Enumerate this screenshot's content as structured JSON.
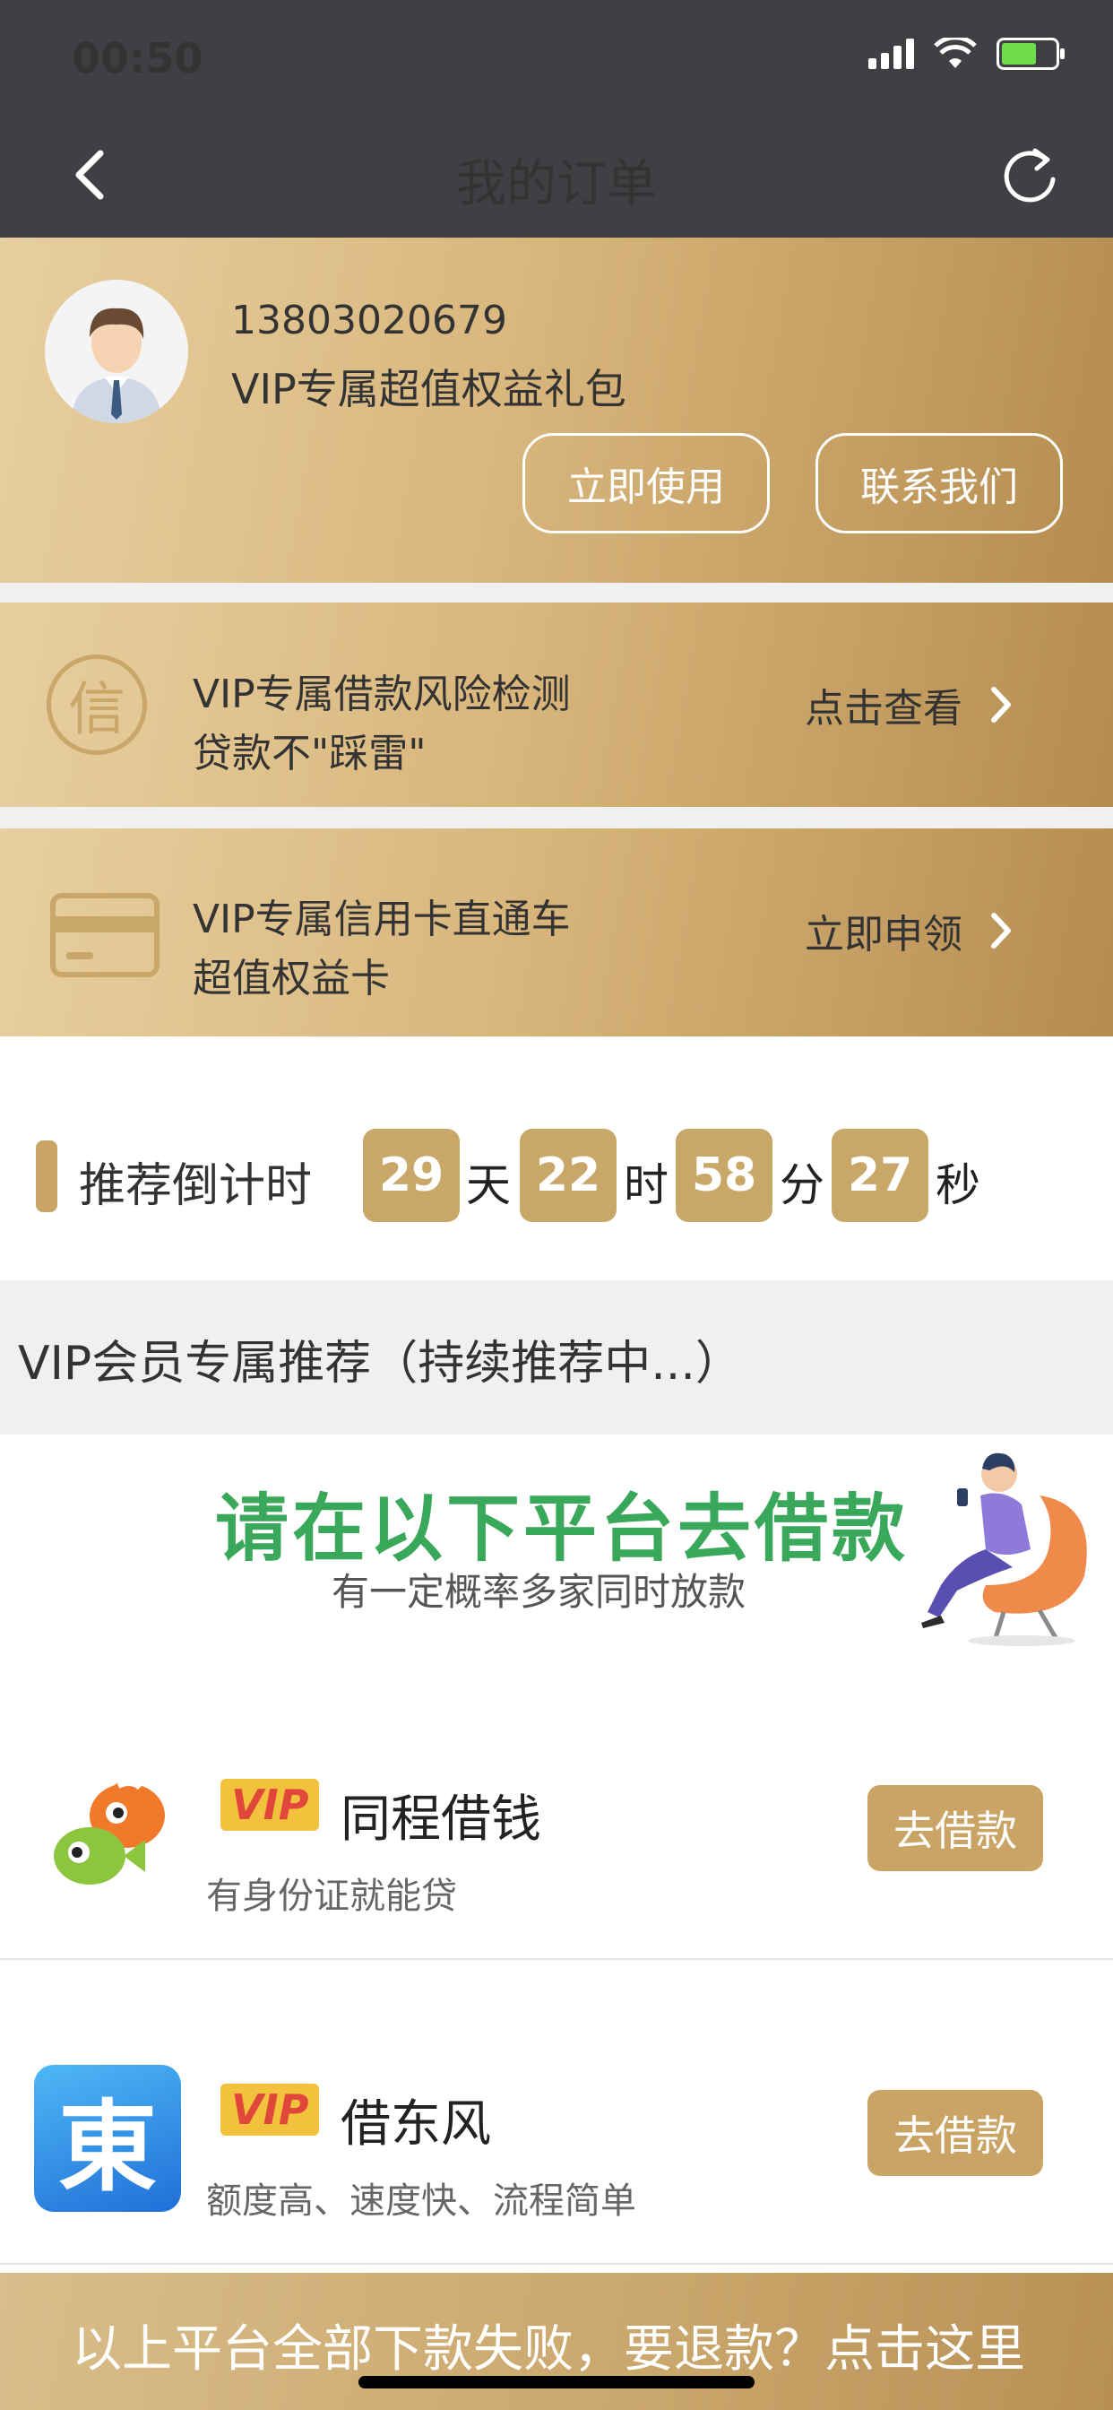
{
  "status_bar": {
    "time": "00:50"
  },
  "nav": {
    "title": "我的订单"
  },
  "profile": {
    "phone": "13803020679",
    "package": "VIP专属超值权益礼包",
    "use_label": "立即使用",
    "contact_label": "联系我们"
  },
  "banners": [
    {
      "icon": "credit-seal-icon",
      "icon_text": "信",
      "line1": "VIP专属借款风险检测",
      "line2": "贷款不\"踩雷\"",
      "action": "点击查看"
    },
    {
      "icon": "credit-card-icon",
      "line1": "VIP专属信用卡直通车",
      "line2": "超值权益卡",
      "action": "立即申领"
    }
  ],
  "countdown": {
    "label": "推荐倒计时",
    "days": "29",
    "days_unit": "天",
    "hours": "22",
    "hours_unit": "时",
    "minutes": "58",
    "minutes_unit": "分",
    "seconds": "27",
    "seconds_unit": "秒"
  },
  "recommend": {
    "title": "VIP会员专属推荐（持续推荐中...）"
  },
  "promo": {
    "headline": "请在以下平台去借款",
    "subline": "有一定概率多家同时放款"
  },
  "lenders": [
    {
      "tag": "VIP",
      "name": "同程借钱",
      "desc": "有身份证就能贷",
      "button": "去借款",
      "icon": "tongcheng-fish-icon"
    },
    {
      "tag": "VIP",
      "name": "借东风",
      "desc": "额度高、速度快、流程简单",
      "button": "去借款",
      "icon": "dongfeng-logo-icon",
      "icon_text": "東"
    }
  ],
  "footer": {
    "text": "以上平台全部下款失败，要退款？点击这里"
  },
  "colors": {
    "gold": "#c9a465",
    "promo_green": "#3aa85a",
    "vip_yellow": "#f2c23c"
  }
}
